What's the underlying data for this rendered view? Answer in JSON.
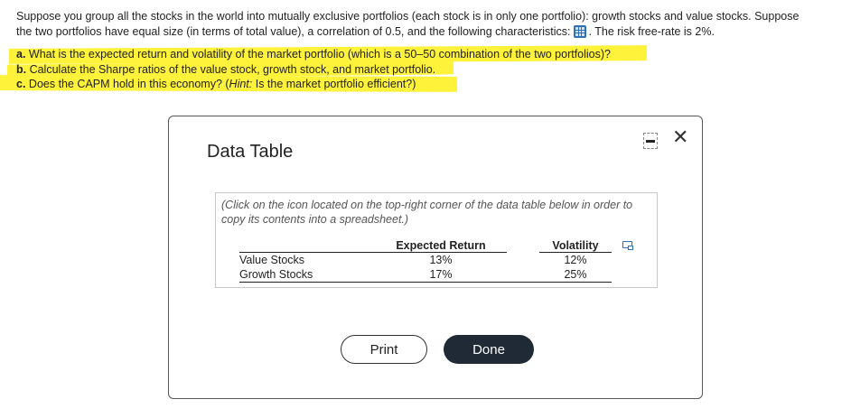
{
  "question": {
    "line1": "Suppose you group all the stocks in the world into mutually exclusive portfolios (each stock is in only one portfolio): growth stocks and value stocks. Suppose",
    "line2_before_icon": "the two portfolios have equal size (in terms of total value), a correlation of 0.5, and the following characteristics:",
    "line2_after_icon": ". The risk free-rate is 2%.",
    "a_prefix": "a.",
    "a_text": " What is the expected return and volatility of the market portfolio (which is a 50–50 combination of the two portfolios)?",
    "b_prefix": "b.",
    "b_text": " Calculate the Sharpe ratios of the value stock, growth stock, and market portfolio.",
    "c_prefix": "c.",
    "c_text_before_hint": " Does the CAPM hold in this economy? (",
    "c_hint": "Hint:",
    "c_text_after_hint": " Is the market portfolio efficient?)",
    "highlight_color": "#fff23a"
  },
  "dialog": {
    "title": "Data Table",
    "close_symbol": "✕",
    "note": "(Click on the icon located on the top-right corner of the data table below in order to copy its contents into a spreadsheet.)",
    "table": {
      "headers": [
        "",
        "Expected Return",
        "Volatility"
      ],
      "rows": [
        {
          "name": "Value Stocks",
          "expected_return": "13%",
          "volatility": "12%"
        },
        {
          "name": "Growth Stocks",
          "expected_return": "17%",
          "volatility": "25%"
        }
      ]
    },
    "print_label": "Print",
    "done_label": "Done"
  },
  "icons": {
    "table_icon": "table-grid-icon",
    "copy_icon": "copy-to-spreadsheet-icon",
    "minimize_icon": "minimize-icon",
    "close_icon": "close-icon"
  },
  "colors": {
    "done_button_bg": "#1f2a36",
    "icon_blue": "#2f6fb3"
  }
}
